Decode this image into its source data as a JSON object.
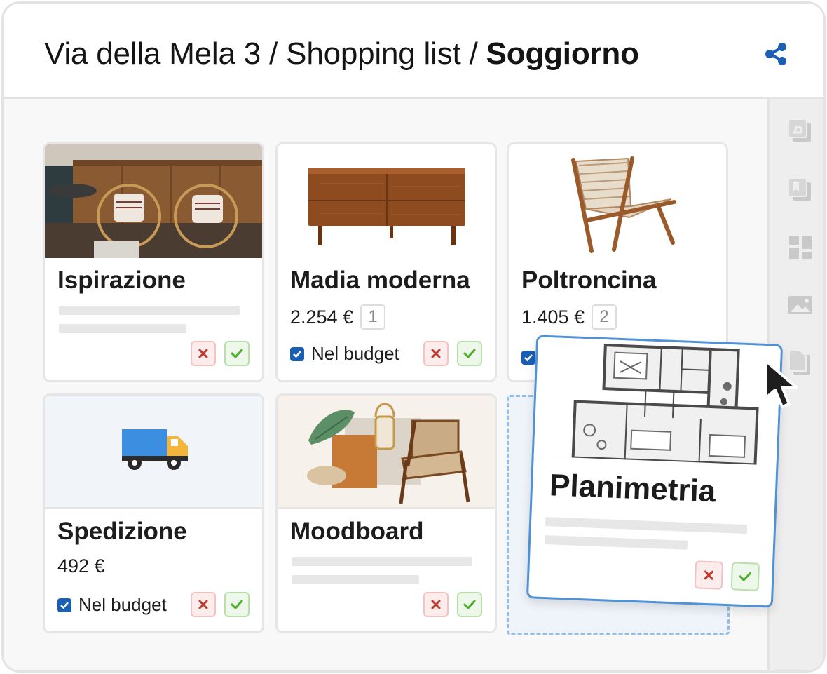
{
  "header": {
    "crumbs": [
      "Via della Mela 3",
      "Shopping list"
    ],
    "separator": "/",
    "current": "Soggiorno"
  },
  "icons": {
    "share": "share-icon",
    "rail": [
      "image-stack-icon",
      "book-stack-icon",
      "dashboard-icon",
      "picture-icon",
      "document-icon"
    ],
    "reject": "close-icon",
    "accept": "check-icon"
  },
  "colors": {
    "accent": "#1a5fb4",
    "reject": "#c0392b",
    "accept": "#4caf2a",
    "drag_border": "#4f93d6"
  },
  "cards": [
    {
      "title": "Ispirazione"
    },
    {
      "title": "Madia moderna",
      "price": "2.254 €",
      "qty": "1",
      "budget": "Nel budget"
    },
    {
      "title": "Poltroncina",
      "price": "1.405 €",
      "qty": "2"
    },
    {
      "title": "Spedizione",
      "price": "492 €",
      "budget": "Nel budget"
    },
    {
      "title": "Moodboard"
    }
  ],
  "dragged_card": {
    "title": "Planimetria"
  }
}
